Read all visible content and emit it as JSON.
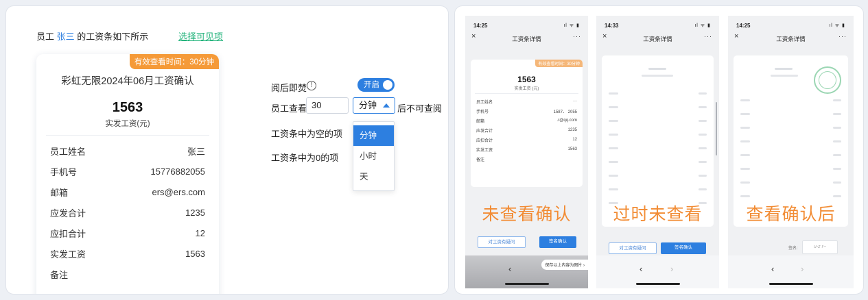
{
  "left": {
    "intro_prefix": "员工",
    "employee": "张三",
    "intro_suffix": "的工资条如下所示",
    "choose_link": "选择可见项",
    "card": {
      "badge": "有效查看时间：30分钟",
      "title": "彩虹无限2024年06月工资确认",
      "amount": "1563",
      "amount_label": "实发工资(元)",
      "rows": [
        {
          "label": "员工姓名",
          "value": "张三"
        },
        {
          "label": "手机号",
          "value": "15776882055"
        },
        {
          "label": "邮箱",
          "value": "ers@ers.com"
        },
        {
          "label": "应发合计",
          "value": "1235"
        },
        {
          "label": "应扣合计",
          "value": "12"
        },
        {
          "label": "实发工资",
          "value": "1563"
        },
        {
          "label": "备注",
          "value": ""
        }
      ]
    },
    "settings": {
      "burn_label": "阅后即焚",
      "toggle_label": "开启",
      "view_label": "员工查看",
      "view_value": "30",
      "unit_selected": "分钟",
      "after_label": "后不可查阅",
      "empty_label": "工资条中为空的项",
      "zero_label": "工资条中为0的项",
      "unit_options": [
        "分钟",
        "小时",
        "天"
      ]
    }
  },
  "phones": {
    "p1": {
      "time": "14:25",
      "title": "工资条详情",
      "badge": "有效查看时间：30分钟",
      "amount": "1563",
      "amount_label": "实发工资 (元)",
      "rows": [
        {
          "label": "员工姓名",
          "value": "···"
        },
        {
          "label": "手机号",
          "value": "1587、 2055"
        },
        {
          "label": "邮箱",
          "value": ".r@qq.com"
        },
        {
          "label": "应发合计",
          "value": "1235"
        },
        {
          "label": "应扣合计",
          "value": "12"
        },
        {
          "label": "实发工资",
          "value": "1563"
        },
        {
          "label": "备注",
          "value": ""
        }
      ],
      "overlay": "未查看确认",
      "question_btn": "对工资有疑问",
      "confirm_btn": "签名确认",
      "save_pill": "保存以上内容为图片 ›"
    },
    "p2": {
      "time": "14:33",
      "title": "工资条详情",
      "overlay": "过时未查看",
      "question_btn": "对工资有疑问",
      "confirm_btn": "签名确认"
    },
    "p3": {
      "time": "14:25",
      "title": "工资条详情",
      "overlay": "查看确认后",
      "sign_label": "签名:",
      "signature": "u-z r~"
    }
  },
  "icons": {
    "close": "×",
    "more": "···",
    "back": "‹",
    "forward": "›",
    "info": "!",
    "status": "ıl ᯤ ▮"
  },
  "colors": {
    "accent": "#2d7fe0",
    "overlay_orange": "#f28c34",
    "link_green": "#20b27a",
    "badge_orange": "#f59a38"
  }
}
